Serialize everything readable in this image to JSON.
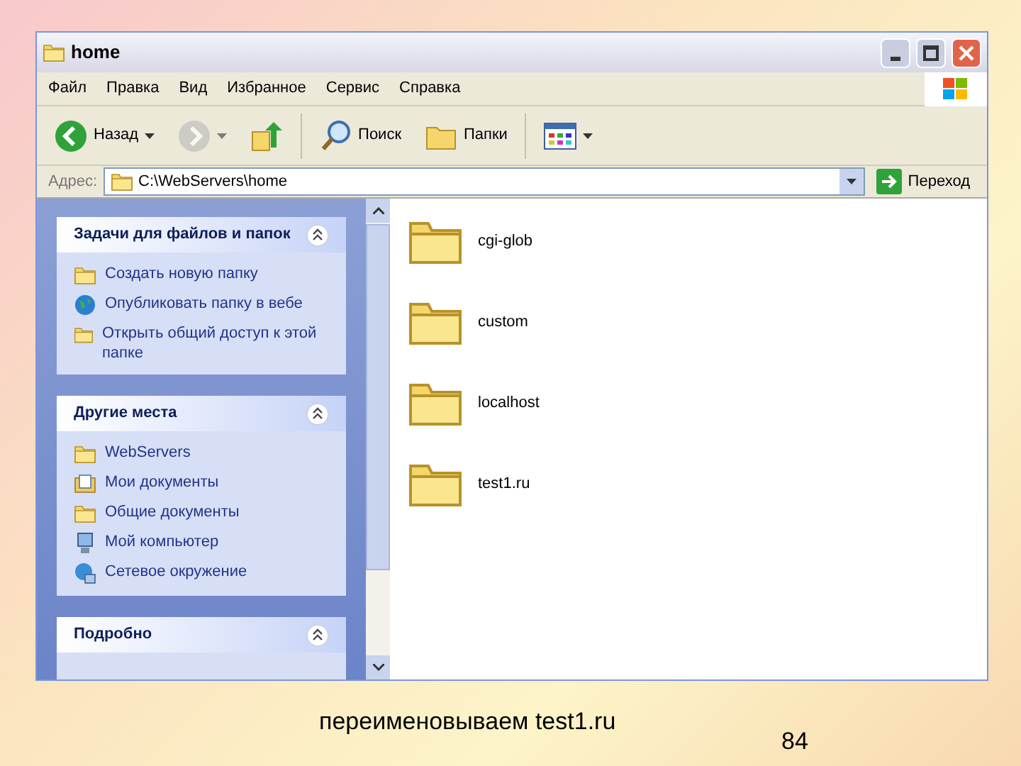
{
  "slide": {
    "caption": "переименовываем test1.ru",
    "page_number": "84"
  },
  "window": {
    "title": "home"
  },
  "menu": [
    "Файл",
    "Правка",
    "Вид",
    "Избранное",
    "Сервис",
    "Справка"
  ],
  "toolbar": [
    {
      "kind": "back",
      "label": "Назад",
      "disabled": false
    },
    {
      "kind": "forward",
      "disabled": true
    },
    {
      "kind": "up",
      "disabled": false
    },
    {
      "kind": "search",
      "label": "Поиск",
      "disabled": false
    },
    {
      "kind": "folders",
      "label": "Папки",
      "disabled": false
    },
    {
      "kind": "views",
      "disabled": false
    }
  ],
  "address": {
    "label": "Адрес:",
    "value": "C:\\WebServers\\home",
    "go": "Переход"
  },
  "panels": [
    {
      "title": "Задачи для файлов и папок",
      "items": [
        {
          "kind": "newfolder",
          "label": "Создать новую папку"
        },
        {
          "kind": "globe",
          "label": "Опубликовать папку в вебе"
        },
        {
          "kind": "share",
          "label": "Открыть общий доступ к этой папке"
        }
      ]
    },
    {
      "title": "Другие места",
      "items": [
        {
          "kind": "folder",
          "label": "WebServers"
        },
        {
          "kind": "docs",
          "label": "Мои документы"
        },
        {
          "kind": "folder",
          "label": "Общие документы"
        },
        {
          "kind": "computer",
          "label": "Мой компьютер"
        },
        {
          "kind": "network",
          "label": "Сетевое окружение"
        }
      ]
    },
    {
      "title": "Подробно"
    }
  ],
  "folders": [
    "cgi-glob",
    "custom",
    "localhost",
    "test1.ru"
  ]
}
